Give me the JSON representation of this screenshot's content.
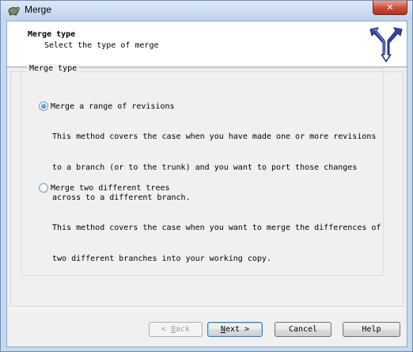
{
  "window": {
    "title": "Merge",
    "close_symbol": "✕"
  },
  "header": {
    "title": "Merge type",
    "subtitle": "Select the type of merge",
    "logo_icon": "merge-arrows-icon",
    "logo_color": "#2b3c9a"
  },
  "groupbox": {
    "legend": "Merge type"
  },
  "options": [
    {
      "label": "Merge a range of revisions",
      "checked": true,
      "description": [
        "This method covers the case when you have made one or more revisions",
        "to a branch (or to the trunk) and you want to port those changes",
        "across to a different branch."
      ]
    },
    {
      "label": "Merge two different trees",
      "checked": false,
      "description": [
        "This method covers the case when you want to merge the differences of",
        "two different branches into your working copy."
      ]
    }
  ],
  "buttons": {
    "back_prefix": "< ",
    "back_accel": "B",
    "back_rest": "ack",
    "next_accel": "N",
    "next_rest": "ext >",
    "cancel": "Cancel",
    "help": "Help"
  },
  "colors": {
    "frame": "#c7d9ee",
    "close": "#c94a35",
    "radio_accent": "#1a6bbd"
  }
}
